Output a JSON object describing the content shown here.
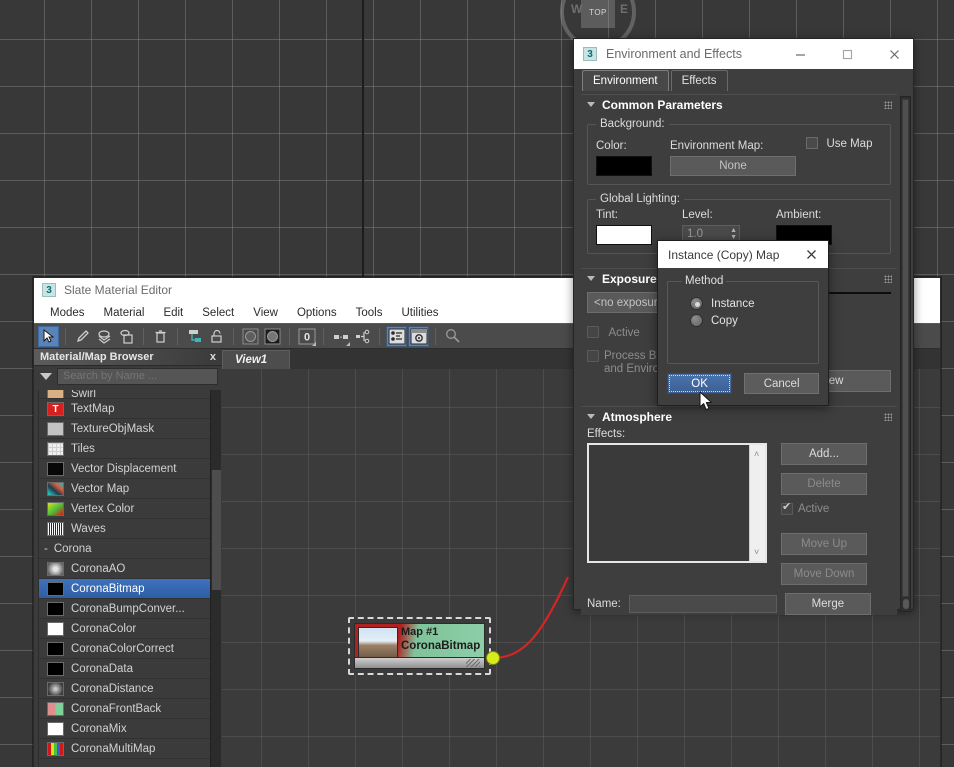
{
  "viewport": {
    "viewcube": {
      "face_label": "TOP",
      "west": "W",
      "east": "E"
    }
  },
  "slate": {
    "title": "Slate Material Editor",
    "app_icon": "3",
    "menu": [
      "Modes",
      "Material",
      "Edit",
      "Select",
      "View",
      "Options",
      "Tools",
      "Utilities"
    ],
    "toolbar_icons": [
      "select-arrow-icon",
      "eyedropper-icon",
      "assign-material-icon",
      "show-map-icon",
      "delete-trash-icon",
      "layout-children-icon",
      "unlock-icon",
      "material-sphere-outline-icon",
      "material-sphere-filled-icon",
      "zero-counter-icon",
      "hide-unused-slots-icon",
      "node-tree-icon",
      "parameter-editor-icon",
      "navigator-icon",
      "select-by-material-icon"
    ],
    "browser": {
      "title": "Material/Map Browser",
      "close_label": "x",
      "search_placeholder": "Search by Name ...",
      "items": [
        {
          "label": "Swirl",
          "swatch": "#d8b083",
          "partial": true
        },
        {
          "label": "TextMap",
          "swatch": "#d81f1f"
        },
        {
          "label": "TextureObjMask",
          "swatch": "#c3c3c3"
        },
        {
          "label": "Tiles",
          "swatch": "#e6e6e6"
        },
        {
          "label": "Vector Displacement",
          "swatch": "#070707"
        },
        {
          "label": "Vector Map",
          "swatch": "#2e5c6e"
        },
        {
          "label": "Vertex Color",
          "swatch": "#6ec12a"
        },
        {
          "label": "Waves",
          "swatch": "#b9b9b9"
        }
      ],
      "group": {
        "expander": "-",
        "label": "Corona"
      },
      "corona_items": [
        {
          "label": "CoronaAO",
          "swatch": "#8d8d8d",
          "selected": false
        },
        {
          "label": "CoronaBitmap",
          "swatch": "#000000",
          "selected": true
        },
        {
          "label": "CoronaBumpConver...",
          "swatch": "#000000",
          "selected": false
        },
        {
          "label": "CoronaColor",
          "swatch": "#ffffff",
          "selected": false
        },
        {
          "label": "CoronaColorCorrect",
          "swatch": "#000000",
          "selected": false
        },
        {
          "label": "CoronaData",
          "swatch": "#000000",
          "selected": false
        },
        {
          "label": "CoronaDistance",
          "swatch": "#777777",
          "selected": false
        },
        {
          "label": "CoronaFrontBack",
          "swatch": "#e08f8f",
          "selected": false
        },
        {
          "label": "CoronaMix",
          "swatch": "#ffffff",
          "selected": false
        },
        {
          "label": "CoronaMultiMap",
          "swatch": "#c04040",
          "selected": false
        }
      ]
    },
    "view_tab": "View1",
    "node": {
      "title": "Map #1",
      "subtitle": "CoronaBitmap"
    }
  },
  "env": {
    "title": "Environment and Effects",
    "app_icon": "3",
    "window_buttons": {
      "minimize": "minimize-icon",
      "maximize": "maximize-icon",
      "close": "close-icon"
    },
    "tabs": [
      {
        "label": "Environment",
        "active": true
      },
      {
        "label": "Effects",
        "active": false
      }
    ],
    "common_parameters": {
      "header": "Common Parameters",
      "background_legend": "Background:",
      "color_label": "Color:",
      "color_value": "#000000",
      "environment_map_label": "Environment Map:",
      "environment_map_value": "None",
      "use_map_label": "Use Map",
      "use_map_checked": false,
      "global_lighting_legend": "Global Lighting:",
      "tint_label": "Tint:",
      "tint_value": "#ffffff",
      "level_label": "Level:",
      "level_value": "1.0",
      "ambient_label": "Ambient:",
      "ambient_value": "#000000"
    },
    "exposure_control": {
      "header": "Exposure C",
      "selected": "<no exposure",
      "active_label": "Active",
      "active_checked": false,
      "process_label_line1": "Process Bac",
      "process_label_line2": "and Environ",
      "process_checked": false,
      "preview_label": "Preview"
    },
    "atmosphere": {
      "header": "Atmosphere",
      "effects_label": "Effects:",
      "effects_items": [],
      "add_label": "Add...",
      "delete_label": "Delete",
      "active_label": "Active",
      "active_checked": true,
      "move_up_label": "Move Up",
      "move_down_label": "Move Down",
      "name_label": "Name:",
      "name_value": "",
      "merge_label": "Merge"
    }
  },
  "modal": {
    "title": "Instance (Copy) Map",
    "close_icon": "close-icon",
    "method_legend": "Method",
    "options": [
      {
        "label": "Instance",
        "selected": true
      },
      {
        "label": "Copy",
        "selected": false
      }
    ],
    "ok_label": "OK",
    "cancel_label": "Cancel"
  },
  "colors": {
    "accent_blue": "#3f72bd",
    "ok_button": "#4a74ae",
    "node_socket": "#d6ec1c",
    "wire": "#d42525"
  }
}
